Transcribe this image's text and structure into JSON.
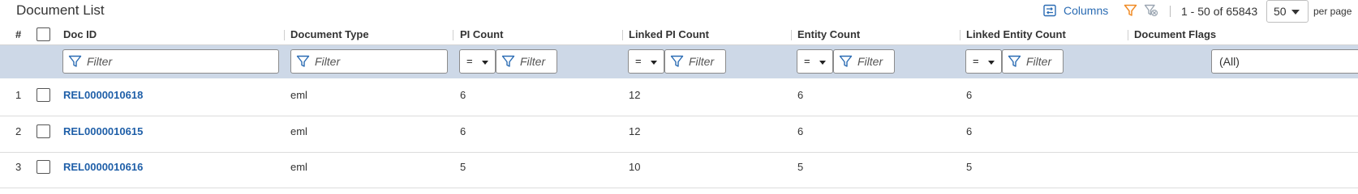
{
  "toolbar": {
    "title": "Document List",
    "columns_label": "Columns",
    "range_text": "1 - 50 of 65843",
    "page_size": "50",
    "per_page_label": "per page",
    "filter_color": "#f08a24",
    "clear_filter_color": "#9aa5b1"
  },
  "columns": {
    "num": "#",
    "doc_id": "Doc ID",
    "doc_type": "Document Type",
    "pi_count": "PI Count",
    "linked_pi_count": "Linked PI Count",
    "entity_count": "Entity Count",
    "linked_entity_count": "Linked Entity Count",
    "doc_flags": "Document Flags"
  },
  "filters": {
    "placeholder": "Filter",
    "operator": "=",
    "flags_value": "(All)"
  },
  "rows": [
    {
      "num": "1",
      "doc_id": "REL0000010618",
      "doc_type": "eml",
      "pi_count": "6",
      "linked_pi_count": "12",
      "entity_count": "6",
      "linked_entity_count": "6"
    },
    {
      "num": "2",
      "doc_id": "REL0000010615",
      "doc_type": "eml",
      "pi_count": "6",
      "linked_pi_count": "12",
      "entity_count": "6",
      "linked_entity_count": "6"
    },
    {
      "num": "3",
      "doc_id": "REL0000010616",
      "doc_type": "eml",
      "pi_count": "5",
      "linked_pi_count": "10",
      "entity_count": "5",
      "linked_entity_count": "5"
    }
  ]
}
